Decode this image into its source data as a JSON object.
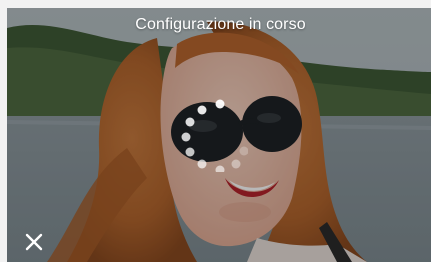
{
  "overlay": {
    "status_text": "Configurazione in corso"
  },
  "icons": {
    "close": "close-icon",
    "spinner": "loading-spinner-icon"
  },
  "colors": {
    "overlay_text": "#ffffff",
    "spinner_dots": "#ffffff"
  }
}
